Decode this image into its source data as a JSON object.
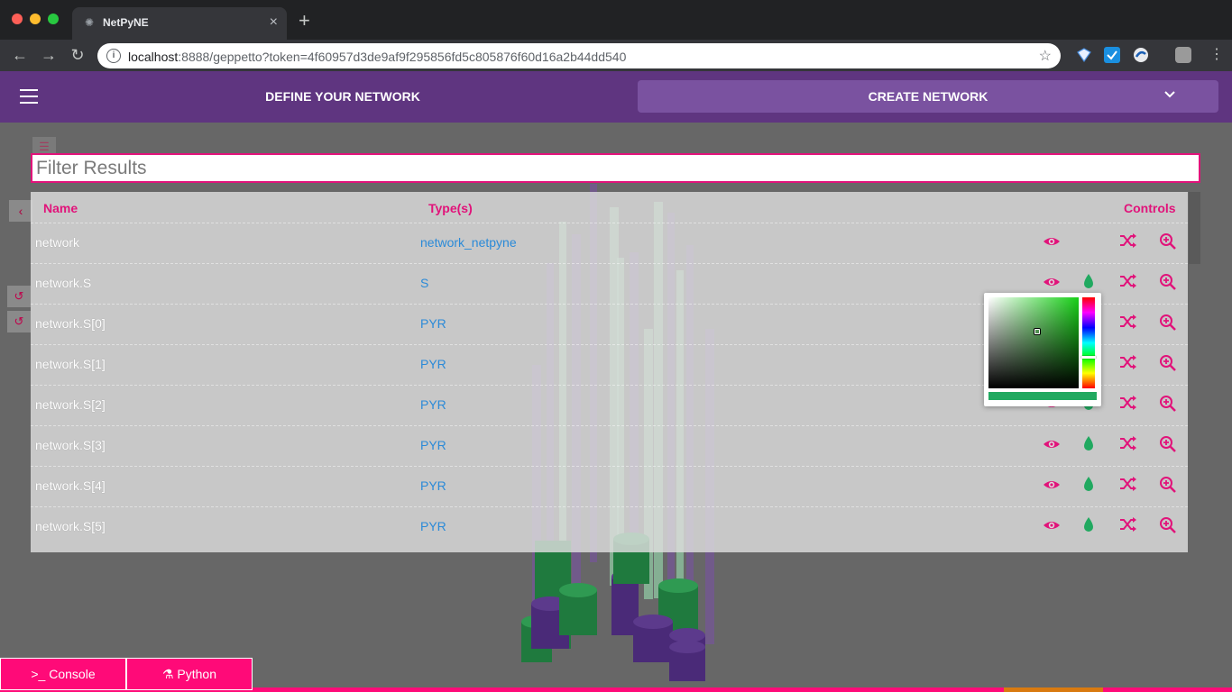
{
  "browser": {
    "tab_title": "NetPyNE",
    "url_host": "localhost",
    "url_rest": ":8888/geppetto?token=4f60957d3de9af9f295856fd5c805876f60d16a2b44dd540"
  },
  "header": {
    "define_label": "DEFINE YOUR NETWORK",
    "create_label": "CREATE NETWORK",
    "background": "#5f3580",
    "active_tab_background": "#7a52a0"
  },
  "filter": {
    "placeholder": "Filter Results",
    "value": ""
  },
  "table": {
    "columns": [
      "Name",
      "Type(s)",
      "Controls"
    ],
    "rows": [
      {
        "name": "network",
        "type": "network_netpyne",
        "has_color": false
      },
      {
        "name": "network.S",
        "type": "S",
        "has_color": true
      },
      {
        "name": "network.S[0]",
        "type": "PYR",
        "has_color": true
      },
      {
        "name": "network.S[1]",
        "type": "PYR",
        "has_color": true
      },
      {
        "name": "network.S[2]",
        "type": "PYR",
        "has_color": true
      },
      {
        "name": "network.S[3]",
        "type": "PYR",
        "has_color": true
      },
      {
        "name": "network.S[4]",
        "type": "PYR",
        "has_color": true
      },
      {
        "name": "network.S[5]",
        "type": "PYR",
        "has_color": true
      }
    ],
    "controls_icons": [
      "eye-icon",
      "color-drop-icon",
      "shuffle-icon",
      "zoom-in-icon"
    ]
  },
  "colors": {
    "accent": "#e1137a",
    "link": "#2a8ad8",
    "selected_color": "#21a960",
    "bottom_bar": "#ff0a78"
  },
  "bottom": {
    "console_label": "Console",
    "python_label": "Python"
  }
}
